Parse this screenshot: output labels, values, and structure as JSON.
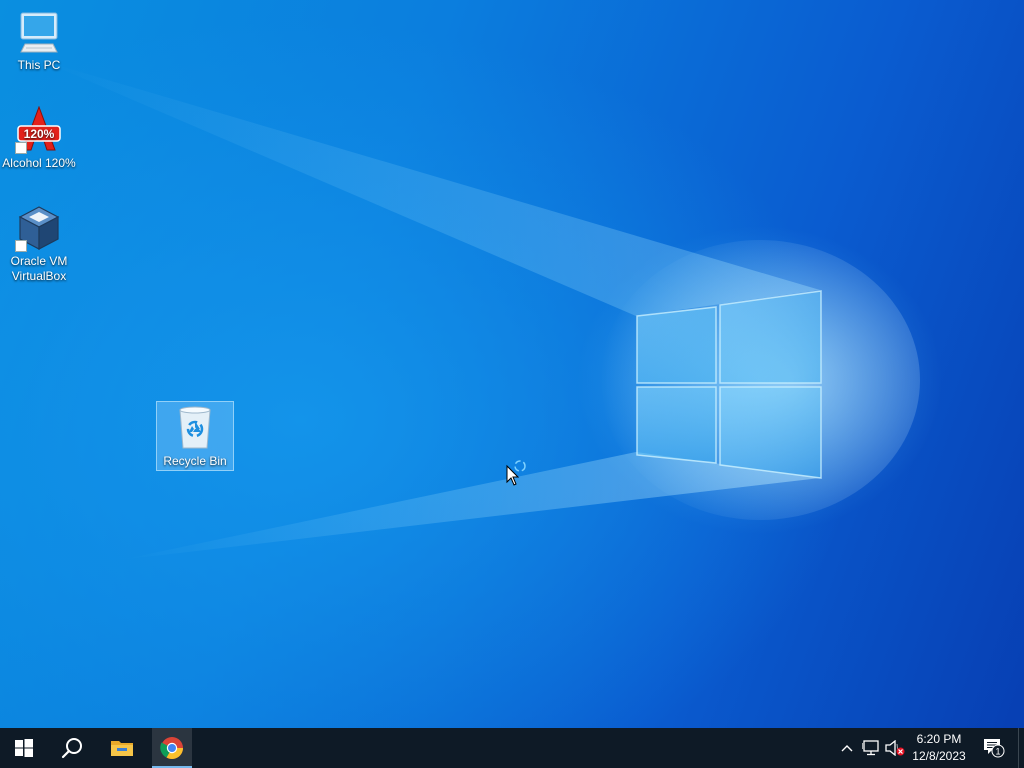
{
  "desktop": {
    "icons": [
      {
        "label": "This PC",
        "icon": "this-pc-icon"
      },
      {
        "label": "Alcohol 120%",
        "icon": "alcohol-120-icon",
        "badge_text": "120%"
      },
      {
        "label": "Oracle VM VirtualBox",
        "icon": "virtualbox-icon"
      },
      {
        "label": "Recycle Bin",
        "icon": "recycle-bin-icon",
        "selected": true
      }
    ]
  },
  "taskbar": {
    "start_icon": "windows-start-icon",
    "search_icon": "search-icon",
    "pinned": [
      {
        "name": "file-explorer",
        "icon": "folder-icon"
      },
      {
        "name": "google-chrome",
        "icon": "chrome-icon",
        "active": true
      }
    ],
    "tray": {
      "overflow_icon": "chevron-up-icon",
      "network_icon": "network-icon",
      "volume_icon": "volume-muted-icon",
      "notification_count": "1"
    },
    "clock": {
      "time": "6:20 PM",
      "date": "12/8/2023"
    }
  },
  "colors": {
    "taskbar_bg": "#0e1a26",
    "accent": "#76b9ed",
    "wallpaper_primary": "#0b7ede"
  }
}
